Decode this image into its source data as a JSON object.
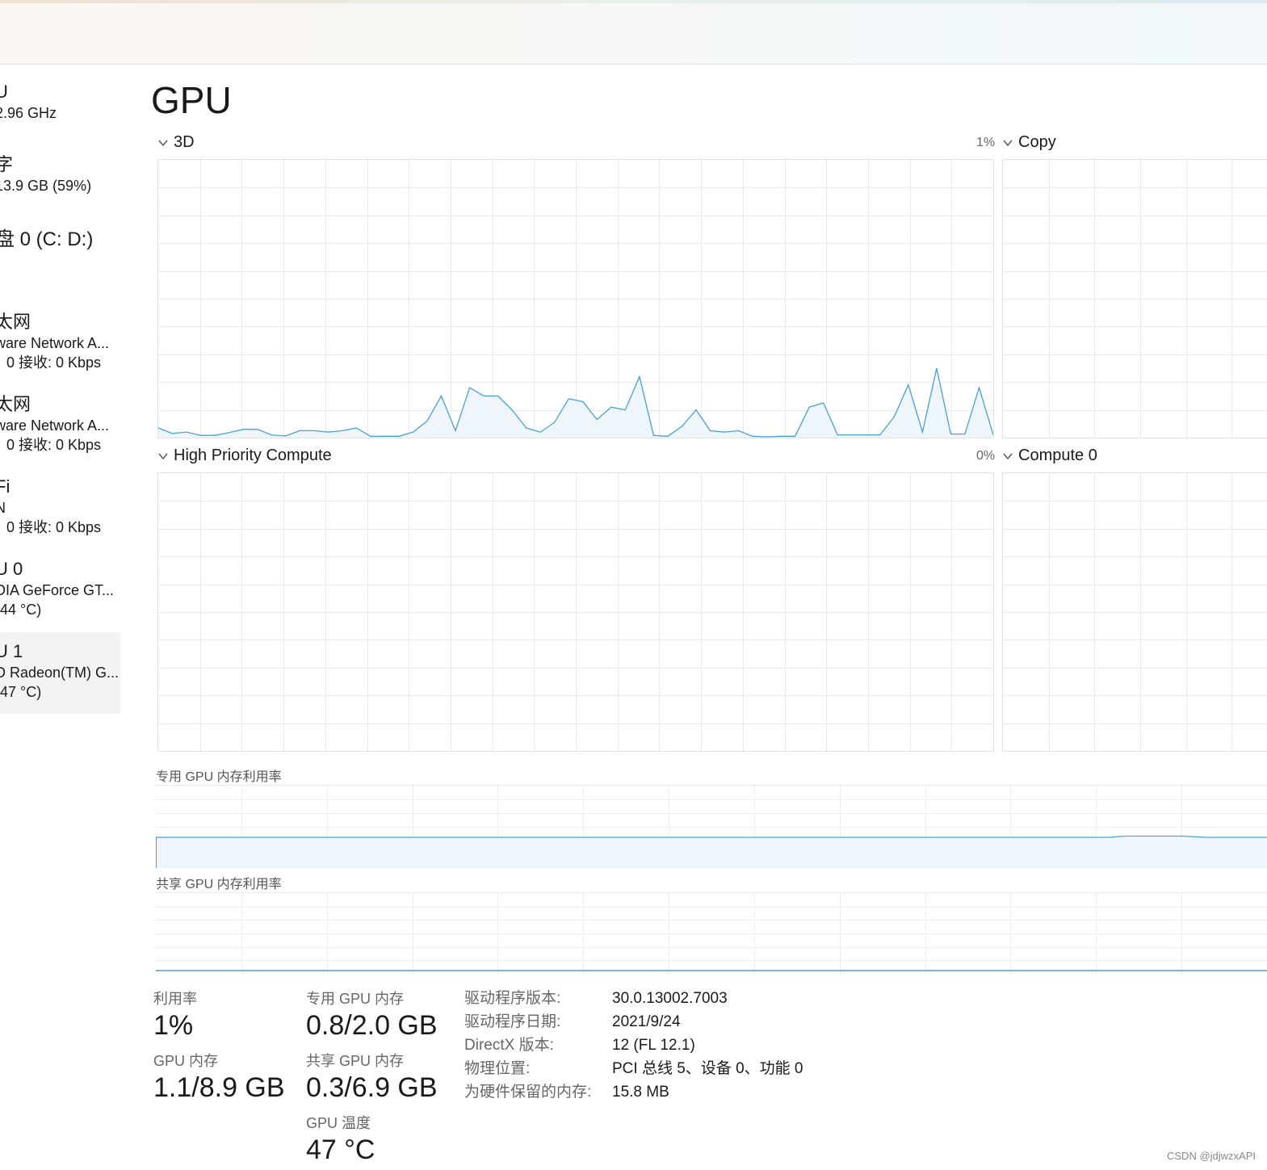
{
  "page_title": "GPU",
  "sidebar": {
    "items": [
      {
        "title": "U",
        "line1": "2.96 GHz",
        "line2": ""
      },
      {
        "title": "字",
        "line1": "13.9 GB (59%)",
        "line2": ""
      },
      {
        "title": "盘 0 (C: D:)",
        "line1": "",
        "line2": ""
      },
      {
        "title": "太网",
        "line1": "ware Network A...",
        "line2": "0 接收: 0 Kbps"
      },
      {
        "title": "太网",
        "line1": "ware Network A...",
        "line2": "0 接收: 0 Kbps"
      },
      {
        "title": "Fi",
        "line1": "N",
        "line2": "0 接收: 0 Kbps"
      },
      {
        "title": "U 0",
        "line1": "DIA GeForce GT...",
        "line2": "(44 °C)"
      },
      {
        "title": "U 1",
        "line1": "D Radeon(TM) G...",
        "line2": "(47 °C)"
      }
    ]
  },
  "graphs": {
    "g3d": {
      "label": "3D",
      "percent": "1%"
    },
    "copy": {
      "label": "Copy"
    },
    "hpc": {
      "label": "High Priority Compute",
      "percent": "0%"
    },
    "compute0": {
      "label": "Compute 0"
    }
  },
  "memory_graphs": {
    "dedicated_label": "专用 GPU 内存利用率",
    "shared_label": "共享 GPU 内存利用率"
  },
  "stats": {
    "utilization_label": "利用率",
    "utilization_value": "1%",
    "dedicated_label": "专用 GPU 内存",
    "dedicated_value": "0.8/2.0 GB",
    "gpu_mem_label": "GPU 内存",
    "gpu_mem_value": "1.1/8.9 GB",
    "shared_label": "共享 GPU 内存",
    "shared_value": "0.3/6.9 GB",
    "temp_label": "GPU 温度",
    "temp_value": "47 °C"
  },
  "info": {
    "driver_version_key": "驱动程序版本:",
    "driver_version_val": "30.0.13002.7003",
    "driver_date_key": "驱动程序日期:",
    "driver_date_val": "2021/9/24",
    "directx_key": "DirectX 版本:",
    "directx_val": "12 (FL 12.1)",
    "location_key": "物理位置:",
    "location_val": "PCI 总线 5、设备 0、功能 0",
    "reserved_key": "为硬件保留的内存:",
    "reserved_val": "15.8 MB"
  },
  "watermark": "CSDN @jdjwzxAPI",
  "colors": {
    "line": "#4aa0d0",
    "fill": "#eef5fb",
    "grid": "#e9e9e9"
  },
  "chart_data": {
    "type": "line",
    "title": "3D",
    "ylim": [
      0,
      100
    ],
    "values": [
      3.5,
      1.5,
      2.0,
      0.8,
      0.8,
      1.8,
      3.0,
      3.0,
      1.0,
      0.6,
      2.5,
      2.5,
      2.0,
      2.5,
      3.5,
      0.5,
      0.5,
      0.5,
      2.0,
      6.0,
      15.0,
      2.5,
      18.0,
      15.0,
      15.0,
      10.0,
      3.5,
      2.0,
      5.5,
      14.0,
      13.0,
      6.5,
      11.0,
      10.0,
      22.0,
      0.8,
      0.5,
      4.0,
      10.0,
      2.5,
      2.0,
      2.5,
      0.5,
      0.3,
      0.5,
      0.5,
      11.0,
      12.5,
      1.0,
      1.0,
      1.0,
      1.0,
      7.5,
      19.0,
      2.0,
      25.0,
      1.3,
      1.3,
      18.0,
      1.0
    ]
  }
}
